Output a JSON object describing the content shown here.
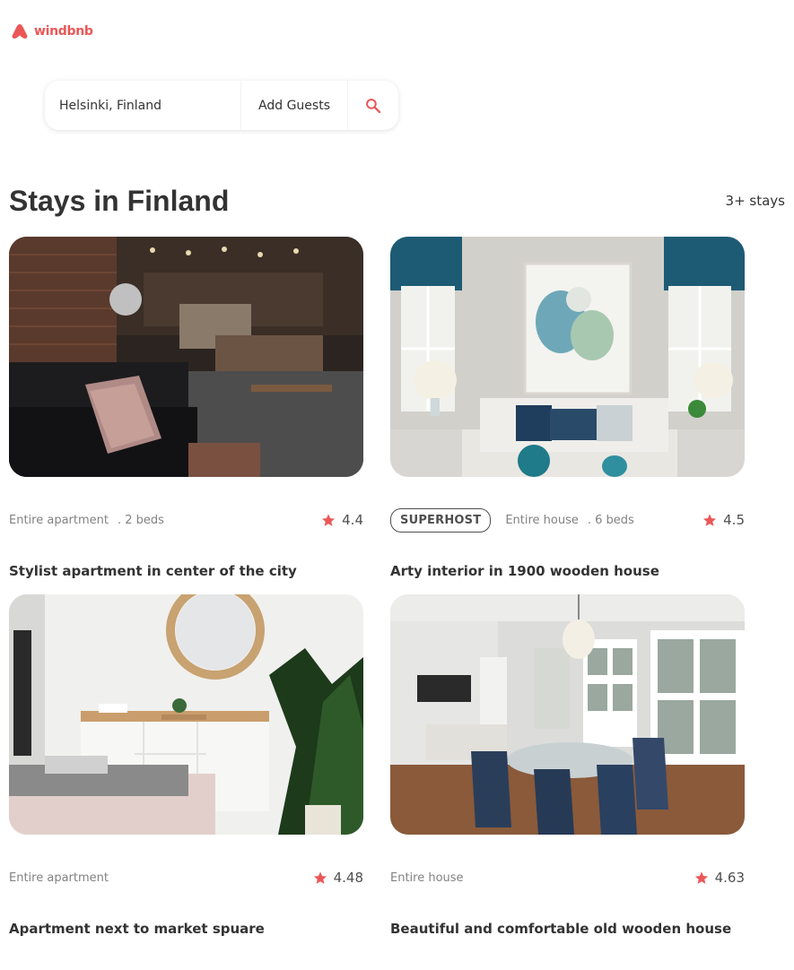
{
  "brand": {
    "name": "windbnb",
    "color": "#EB5757"
  },
  "search": {
    "location": "Helsinki, Finland",
    "guests": "Add Guests",
    "icon": "search-icon"
  },
  "page": {
    "heading": "Stays in Finland",
    "count": "3+ stays"
  },
  "stays": [
    {
      "superhost": false,
      "badge": "",
      "type": "Entire apartment",
      "beds": ". 2 beds",
      "rating": "4.4",
      "title": "Stylist apartment in center of the city"
    },
    {
      "superhost": true,
      "badge": "SUPERHOST",
      "type": "Entire house",
      "beds": ". 6 beds",
      "rating": "4.5",
      "title": "Arty interior in 1900 wooden house"
    },
    {
      "superhost": false,
      "badge": "",
      "type": "Entire apartment",
      "beds": "",
      "rating": "4.48",
      "title": "Apartment next to market spuare"
    },
    {
      "superhost": false,
      "badge": "",
      "type": "Entire house",
      "beds": "",
      "rating": "4.63",
      "title": "Beautiful and comfortable old wooden house"
    }
  ],
  "colors": {
    "star": "#EB5757",
    "text": "#333333",
    "muted": "#828282",
    "badge_border": "#4F4F4F"
  }
}
